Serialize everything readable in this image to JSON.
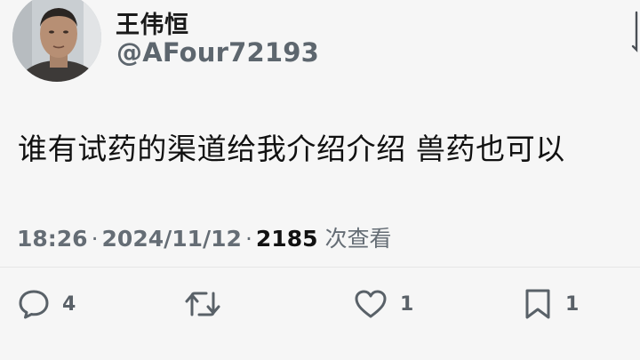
{
  "user": {
    "display_name": "王伟恒",
    "handle": "@AFour72193"
  },
  "tweet": {
    "text": "谁有试药的渠道给我介绍介绍 兽药也可以"
  },
  "meta": {
    "time": "18:26",
    "date": "2024/11/12",
    "views_count": "2185",
    "views_label": "次查看",
    "separator": "·"
  },
  "actions": {
    "reply": {
      "icon": "reply-icon",
      "count": "4"
    },
    "retweet": {
      "icon": "retweet-icon",
      "count": ""
    },
    "like": {
      "icon": "heart-icon",
      "count": "1"
    },
    "bookmark": {
      "icon": "bookmark-icon",
      "count": "1"
    }
  },
  "colors": {
    "background": "#f6f6f6",
    "text": "#111111",
    "secondary": "#656d75"
  }
}
